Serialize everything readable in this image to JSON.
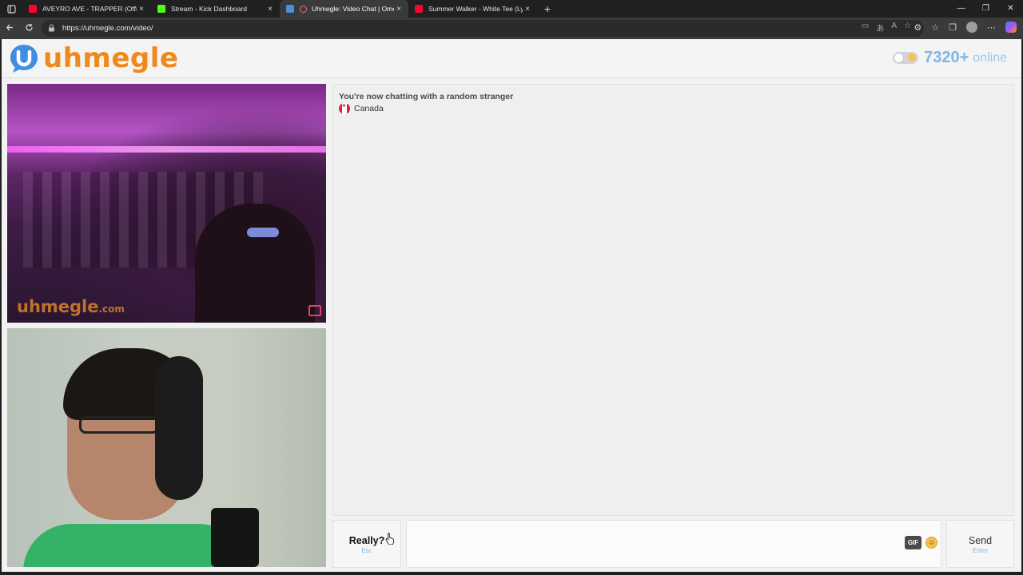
{
  "browser": {
    "tabs": [
      {
        "title": "AVEYRO AVE - TRAPPER (Official M",
        "favicon_color": "#ff0033",
        "active": false
      },
      {
        "title": "Stream - Kick Dashboard",
        "favicon_color": "#53fc18",
        "active": false
      },
      {
        "title": "Uhmegle: Video Chat | Omeg",
        "favicon_color": "#4a8fd8",
        "active": true
      },
      {
        "title": "Summer Walker - White Tee (Lyric",
        "favicon_color": "#ff0033",
        "active": false
      }
    ],
    "close_glyph": "×",
    "new_tab_glyph": "+",
    "window_controls": {
      "minimize": "—",
      "restore": "❐",
      "close": "✕"
    },
    "url": "https://uhmegle.com/video/"
  },
  "header": {
    "logo_text": "uhmegle",
    "online_count": "7320+",
    "online_label": "online"
  },
  "stranger_video": {
    "watermark": "uhmegle",
    "watermark_suffix": ".com"
  },
  "chat": {
    "status": "You're now chatting with a random stranger",
    "country": "Canada"
  },
  "controls": {
    "skip_label": "Really?",
    "skip_key": "Esc",
    "message_placeholder": "",
    "gif_label": "GIF",
    "send_label": "Send",
    "send_key": "Enter"
  },
  "colors": {
    "brand_orange": "#f0891c",
    "online_blue": "#7fb6e8"
  }
}
